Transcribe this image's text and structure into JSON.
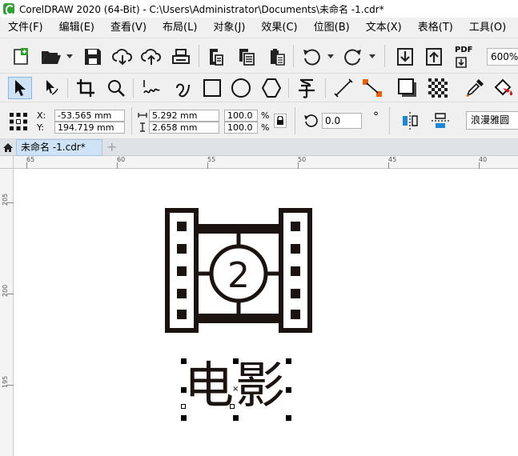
{
  "window": {
    "title": "CorelDRAW 2020 (64-Bit) - C:\\Users\\Administrator\\Documents\\未命名 -1.cdr*"
  },
  "menu": [
    "文件(F)",
    "编辑(E)",
    "查看(V)",
    "布局(L)",
    "对象(J)",
    "效果(C)",
    "位图(B)",
    "文本(X)",
    "表格(T)",
    "工具(O)"
  ],
  "standard_toolbar": {
    "pdf_label": "PDF",
    "zoom": "600%"
  },
  "property_bar": {
    "x_label": "X:",
    "y_label": "Y:",
    "x_value": "-53.565 mm",
    "y_value": "194.719 mm",
    "width_value": "5.292 mm",
    "height_value": "2.658 mm",
    "scale_w": "100.0",
    "scale_h": "100.0",
    "percent": "%",
    "rotation": "0.0",
    "degree": "°",
    "font_name": "浪漫雅圆"
  },
  "tabs": {
    "document_tab": "未命名 -1.cdr*",
    "add_tab": "+"
  },
  "ruler": {
    "h_labels": [
      "65",
      "60",
      "55",
      "50",
      "45",
      "40"
    ],
    "v_labels": [
      "205",
      "200",
      "195"
    ]
  },
  "canvas": {
    "film_number": "2",
    "text": "电影"
  },
  "colors": {
    "ink": "#1a1310",
    "tab_active": "#cfe3f7",
    "toolbar_bg": "#f0f0f0"
  }
}
